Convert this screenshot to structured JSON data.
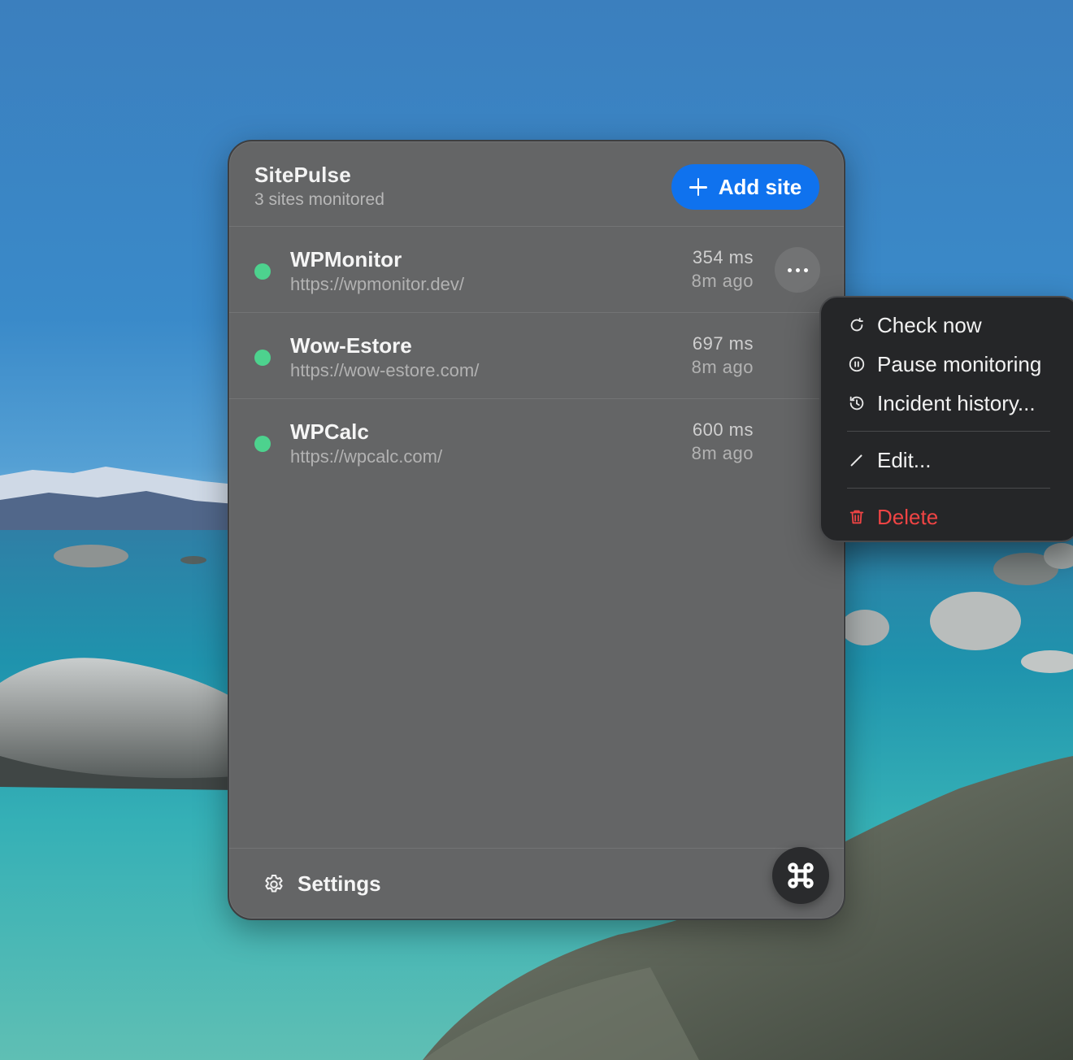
{
  "app": {
    "title": "SitePulse",
    "subtitle": "3 sites monitored",
    "add_site_label": "Add site",
    "settings_label": "Settings",
    "fab_icon": "command-icon"
  },
  "colors": {
    "accent": "#0f72ee",
    "status_up": "#4dd28e",
    "danger": "#ef4444",
    "panel_bg": "#646566",
    "menu_bg": "#252628"
  },
  "sites": [
    {
      "name": "WPMonitor",
      "url": "https://wpmonitor.dev/",
      "latency": "354 ms",
      "checked": "8m ago",
      "status": "up"
    },
    {
      "name": "Wow-Estore",
      "url": "https://wow-estore.com/",
      "latency": "697 ms",
      "checked": "8m ago",
      "status": "up"
    },
    {
      "name": "WPCalc",
      "url": "https://wpcalc.com/",
      "latency": "600 ms",
      "checked": "8m ago",
      "status": "up"
    }
  ],
  "menu": {
    "items": [
      {
        "label": "Check now",
        "icon": "refresh-icon"
      },
      {
        "label": "Pause monitoring",
        "icon": "pause-circle-icon"
      },
      {
        "label": "Incident history...",
        "icon": "history-icon"
      },
      {
        "label": "Edit...",
        "icon": "pencil-icon"
      },
      {
        "label": "Delete",
        "icon": "trash-icon"
      }
    ]
  }
}
